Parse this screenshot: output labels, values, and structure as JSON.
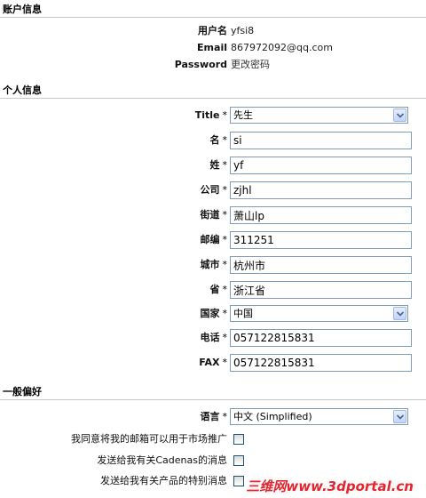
{
  "account": {
    "header": "账户信息",
    "username_label": "用户名",
    "username_value": "yfsi8",
    "email_label": "Email",
    "email_value": "867972092@qq.com",
    "password_label": "Password",
    "password_link": "更改密码"
  },
  "personal": {
    "header": "个人信息",
    "required_mark": "*",
    "title_label": "Title",
    "title_value": "先生",
    "first_name_label": "名",
    "first_name_value": "si",
    "last_name_label": "姓",
    "last_name_value": "yf",
    "company_label": "公司",
    "company_value": "zjhl",
    "street_label": "街道",
    "street_value": "萧山lp",
    "zip_label": "邮编",
    "zip_value": "311251",
    "city_label": "城市",
    "city_value": "杭州市",
    "province_label": "省",
    "province_value": "浙江省",
    "country_label": "国家",
    "country_value": "中国",
    "phone_label": "电话",
    "phone_value": "057122815831",
    "fax_label": "FAX",
    "fax_value": "057122815831"
  },
  "preferences": {
    "header": "一般偏好",
    "language_label": "语言",
    "language_value": "中文 (Simplified)",
    "marketing_consent_label": "我同意将我的邮箱可以用于市场推广",
    "cadenas_news_label": "发送给我有关Cadenas的消息",
    "special_offers_label": "发送给我有关产品的特别消息"
  },
  "watermark": "三维网www.3dportal.cn"
}
